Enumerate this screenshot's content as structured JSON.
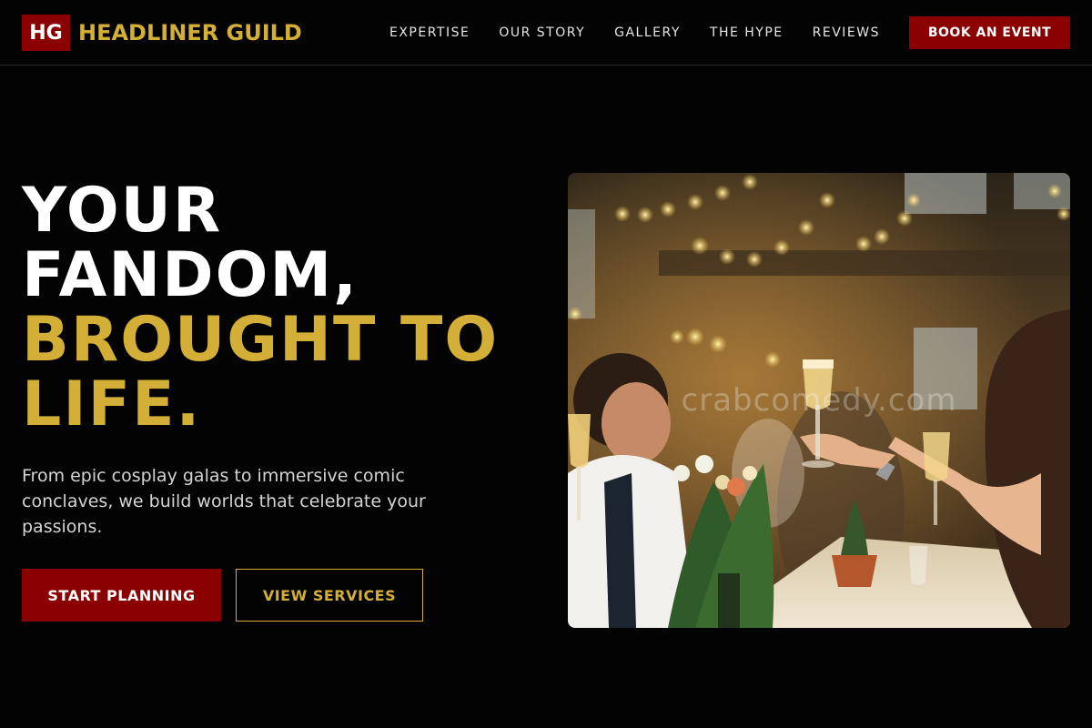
{
  "header": {
    "logo_initials": "HG",
    "brand": "HEADLINER GUILD",
    "nav": [
      "EXPERTISE",
      "OUR STORY",
      "GALLERY",
      "THE HYPE",
      "REVIEWS"
    ],
    "cta": "BOOK AN EVENT"
  },
  "hero": {
    "title_lines_white": [
      "YOUR",
      "FANDOM,"
    ],
    "title_lines_gold": [
      "BROUGHT TO",
      "LIFE."
    ],
    "subtitle": "From epic cosplay galas to immersive comic conclaves, we build worlds that celebrate your passions.",
    "primary_button": "START PLANNING",
    "secondary_button": "VIEW SERVICES",
    "image_watermark": "crabcomedy.com"
  },
  "colors": {
    "background": "#030303",
    "accent_red": "#8b0000",
    "accent_gold": "#d4af37"
  }
}
